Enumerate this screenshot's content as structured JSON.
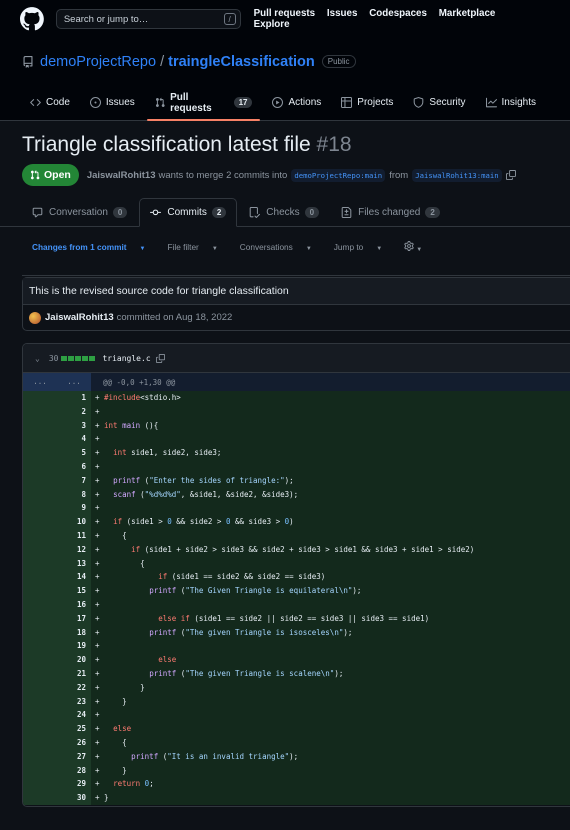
{
  "header": {
    "search_placeholder": "Search or jump to…",
    "search_key": "/",
    "nav": [
      "Pull requests",
      "Issues",
      "Codespaces",
      "Marketplace",
      "Explore"
    ]
  },
  "repo": {
    "owner": "demoProjectRepo",
    "separator": "/",
    "name": "traingleClassification",
    "visibility": "Public",
    "tabs": [
      {
        "label": "Code",
        "icon": "code-icon"
      },
      {
        "label": "Issues",
        "icon": "issue-icon"
      },
      {
        "label": "Pull requests",
        "icon": "pull-request-icon",
        "count": "17",
        "selected": true
      },
      {
        "label": "Actions",
        "icon": "play-icon"
      },
      {
        "label": "Projects",
        "icon": "table-icon"
      },
      {
        "label": "Security",
        "icon": "shield-icon"
      },
      {
        "label": "Insights",
        "icon": "graph-icon"
      }
    ]
  },
  "pr": {
    "title": "Triangle classification latest file",
    "number": "#18",
    "state": "Open",
    "author": "JaiswalRohit13",
    "merge_text": "wants to merge 2 commits into",
    "base_branch": "demoProjectRepo:main",
    "from_text": "from",
    "head_branch": "JaiswalRohit13:main",
    "tabs": [
      {
        "label": "Conversation",
        "count": "0",
        "icon": "comment-icon"
      },
      {
        "label": "Commits",
        "count": "2",
        "icon": "commit-icon",
        "selected": true
      },
      {
        "label": "Checks",
        "count": "0",
        "icon": "checklist-icon"
      },
      {
        "label": "Files changed",
        "count": "2",
        "icon": "file-diff-icon"
      }
    ]
  },
  "toolbar": {
    "commits_filter": "Changes from 1 commit",
    "file_filter": "File filter",
    "conversations": "Conversations",
    "jump_to": "Jump to"
  },
  "commit": {
    "message": "This is the revised source code for triangle classification",
    "author": "JaiswalRohit13",
    "date_text": "committed on Aug 18, 2022"
  },
  "file": {
    "changes": "30",
    "name": "triangle.c",
    "hunk": "@@ -0,0 +1,30 @@",
    "hunk_old": "...",
    "hunk_new": "...",
    "lines": [
      "#include<stdio.h>",
      "",
      "int main (){",
      "",
      "  int side1, side2, side3;",
      "",
      "  printf (\"Enter the sides of triangle:\");",
      "  scanf (\"%d%d%d\", &side1, &side2, &side3);",
      "",
      "  if (side1 > 0 && side2 > 0 && side3 > 0)",
      "    {",
      "      if (side1 + side2 > side3 && side2 + side3 > side1 && side3 + side1 > side2)",
      "        {",
      "            if (side1 == side2 && side2 == side3)",
      "          printf (\"The Given Triangle is equilateral\\n\");",
      "",
      "            else if (side1 == side2 || side2 == side3 || side3 == side1)",
      "          printf (\"The given Triangle is isosceles\\n\");",
      "",
      "            else",
      "          printf (\"The given Triangle is scalene\\n\");",
      "        }",
      "    }",
      "",
      "  else",
      "    {",
      "      printf (\"It is an invalid triangle\");",
      "    }",
      "  return 0;",
      "}"
    ]
  }
}
